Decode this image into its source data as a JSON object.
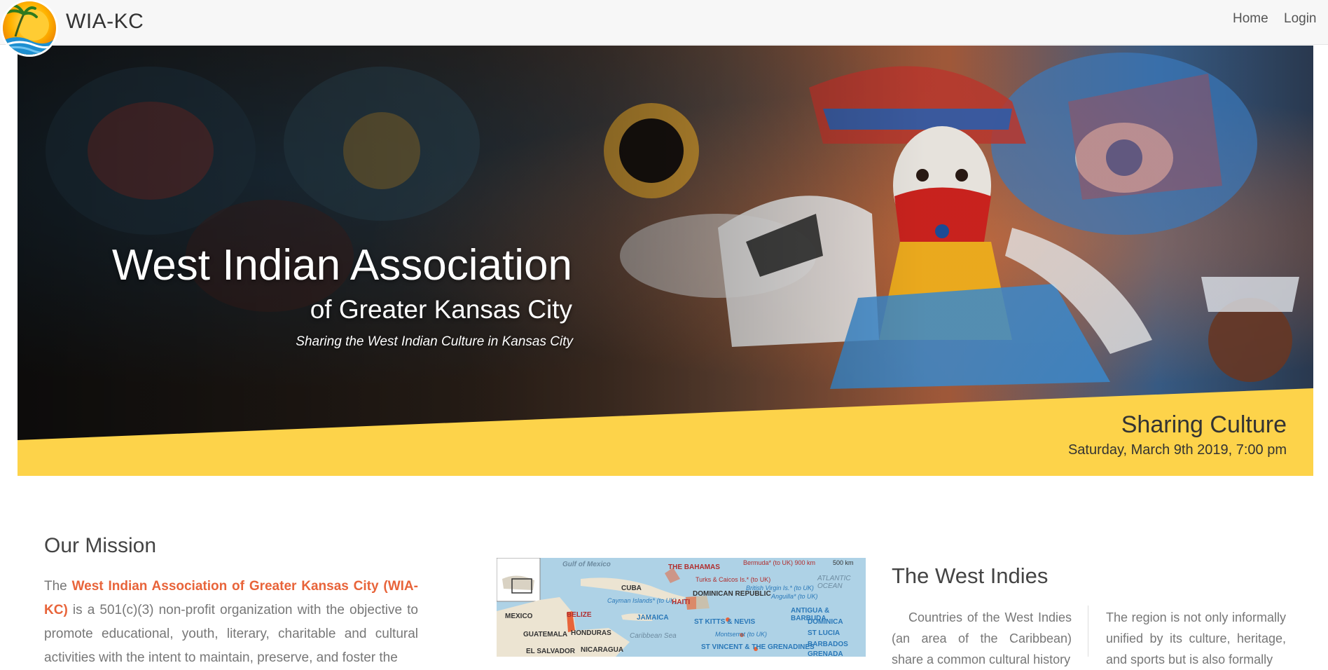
{
  "header": {
    "brand": "WIA-KC",
    "nav": [
      {
        "label": "Home"
      },
      {
        "label": "Login"
      }
    ]
  },
  "hero": {
    "title": "West Indian Association",
    "subtitle": "of Greater Kansas City",
    "tagline": "Sharing the West Indian Culture in Kansas City",
    "event": {
      "title": "Sharing Culture",
      "date": "Saturday, March 9th 2019, 7:00 pm"
    }
  },
  "mission": {
    "heading": "Our Mission",
    "intro": "The ",
    "org_name": "West Indian Association of Greater Kansas City (WIA-KC)",
    "body": " is a 501(c)(3) non-profit organization with the objective to promote educational, youth, literary, charitable and cultural activities with the intent to maintain, preserve, and foster the"
  },
  "map": {
    "labels": [
      "Gulf of Mexico",
      "THE BAHAMAS",
      "Bermuda* (to UK) 900 km",
      "500 km",
      "CUBA",
      "Turks & Caicos Is.* (to UK)",
      "ATLANTIC OCEAN",
      "MEXICO",
      "Cayman Islands* (to UK)",
      "HAITI",
      "DOMINICAN REPUBLIC",
      "British Virgin Is.* (to UK)",
      "Anguilla* (to UK)",
      "BELIZE",
      "JAMAICA",
      "ANTIGUA & BARBUDA",
      "GUATEMALA",
      "HONDURAS",
      "Caribbean Sea",
      "ST KITTS & NEVIS",
      "DOMINICA",
      "Montserrat (to UK)",
      "ST LUCIA",
      "EL SALVADOR",
      "NICARAGUA",
      "ST VINCENT & THE GRENADINES",
      "BARBADOS",
      "GRENADA"
    ]
  },
  "west_indies": {
    "heading": "The West Indies",
    "col1": "Countries of the West Indies (an area of the Caribbean) share a common cultural history",
    "col2": "The region is not only informally unified by its culture, heritage, and sports but is also formally"
  },
  "colors": {
    "accent": "#e8643a",
    "banner": "#fdd34a",
    "navbar": "#f7f7f7"
  }
}
